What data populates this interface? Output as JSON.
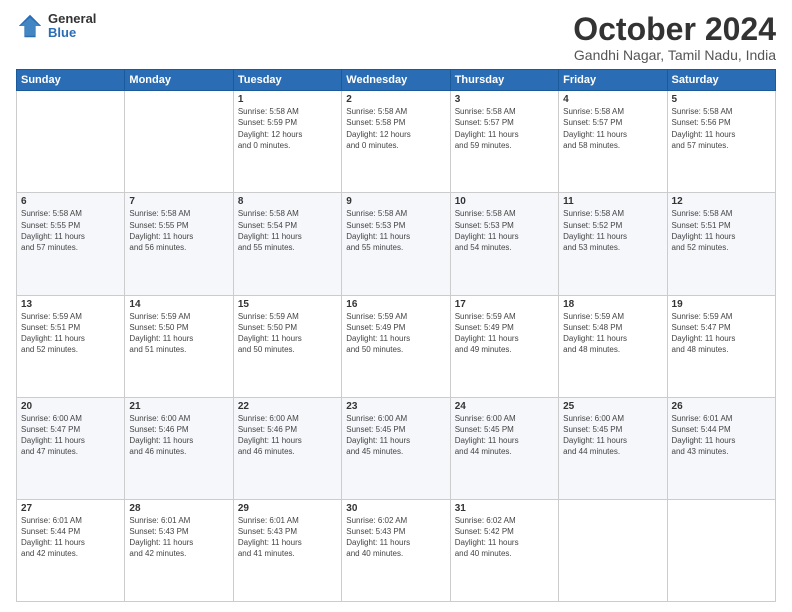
{
  "logo": {
    "general": "General",
    "blue": "Blue"
  },
  "header": {
    "month": "October 2024",
    "location": "Gandhi Nagar, Tamil Nadu, India"
  },
  "days_of_week": [
    "Sunday",
    "Monday",
    "Tuesday",
    "Wednesday",
    "Thursday",
    "Friday",
    "Saturday"
  ],
  "weeks": [
    [
      {
        "day": "",
        "info": ""
      },
      {
        "day": "",
        "info": ""
      },
      {
        "day": "1",
        "info": "Sunrise: 5:58 AM\nSunset: 5:59 PM\nDaylight: 12 hours\nand 0 minutes."
      },
      {
        "day": "2",
        "info": "Sunrise: 5:58 AM\nSunset: 5:58 PM\nDaylight: 12 hours\nand 0 minutes."
      },
      {
        "day": "3",
        "info": "Sunrise: 5:58 AM\nSunset: 5:57 PM\nDaylight: 11 hours\nand 59 minutes."
      },
      {
        "day": "4",
        "info": "Sunrise: 5:58 AM\nSunset: 5:57 PM\nDaylight: 11 hours\nand 58 minutes."
      },
      {
        "day": "5",
        "info": "Sunrise: 5:58 AM\nSunset: 5:56 PM\nDaylight: 11 hours\nand 57 minutes."
      }
    ],
    [
      {
        "day": "6",
        "info": "Sunrise: 5:58 AM\nSunset: 5:55 PM\nDaylight: 11 hours\nand 57 minutes."
      },
      {
        "day": "7",
        "info": "Sunrise: 5:58 AM\nSunset: 5:55 PM\nDaylight: 11 hours\nand 56 minutes."
      },
      {
        "day": "8",
        "info": "Sunrise: 5:58 AM\nSunset: 5:54 PM\nDaylight: 11 hours\nand 55 minutes."
      },
      {
        "day": "9",
        "info": "Sunrise: 5:58 AM\nSunset: 5:53 PM\nDaylight: 11 hours\nand 55 minutes."
      },
      {
        "day": "10",
        "info": "Sunrise: 5:58 AM\nSunset: 5:53 PM\nDaylight: 11 hours\nand 54 minutes."
      },
      {
        "day": "11",
        "info": "Sunrise: 5:58 AM\nSunset: 5:52 PM\nDaylight: 11 hours\nand 53 minutes."
      },
      {
        "day": "12",
        "info": "Sunrise: 5:58 AM\nSunset: 5:51 PM\nDaylight: 11 hours\nand 52 minutes."
      }
    ],
    [
      {
        "day": "13",
        "info": "Sunrise: 5:59 AM\nSunset: 5:51 PM\nDaylight: 11 hours\nand 52 minutes."
      },
      {
        "day": "14",
        "info": "Sunrise: 5:59 AM\nSunset: 5:50 PM\nDaylight: 11 hours\nand 51 minutes."
      },
      {
        "day": "15",
        "info": "Sunrise: 5:59 AM\nSunset: 5:50 PM\nDaylight: 11 hours\nand 50 minutes."
      },
      {
        "day": "16",
        "info": "Sunrise: 5:59 AM\nSunset: 5:49 PM\nDaylight: 11 hours\nand 50 minutes."
      },
      {
        "day": "17",
        "info": "Sunrise: 5:59 AM\nSunset: 5:49 PM\nDaylight: 11 hours\nand 49 minutes."
      },
      {
        "day": "18",
        "info": "Sunrise: 5:59 AM\nSunset: 5:48 PM\nDaylight: 11 hours\nand 48 minutes."
      },
      {
        "day": "19",
        "info": "Sunrise: 5:59 AM\nSunset: 5:47 PM\nDaylight: 11 hours\nand 48 minutes."
      }
    ],
    [
      {
        "day": "20",
        "info": "Sunrise: 6:00 AM\nSunset: 5:47 PM\nDaylight: 11 hours\nand 47 minutes."
      },
      {
        "day": "21",
        "info": "Sunrise: 6:00 AM\nSunset: 5:46 PM\nDaylight: 11 hours\nand 46 minutes."
      },
      {
        "day": "22",
        "info": "Sunrise: 6:00 AM\nSunset: 5:46 PM\nDaylight: 11 hours\nand 46 minutes."
      },
      {
        "day": "23",
        "info": "Sunrise: 6:00 AM\nSunset: 5:45 PM\nDaylight: 11 hours\nand 45 minutes."
      },
      {
        "day": "24",
        "info": "Sunrise: 6:00 AM\nSunset: 5:45 PM\nDaylight: 11 hours\nand 44 minutes."
      },
      {
        "day": "25",
        "info": "Sunrise: 6:00 AM\nSunset: 5:45 PM\nDaylight: 11 hours\nand 44 minutes."
      },
      {
        "day": "26",
        "info": "Sunrise: 6:01 AM\nSunset: 5:44 PM\nDaylight: 11 hours\nand 43 minutes."
      }
    ],
    [
      {
        "day": "27",
        "info": "Sunrise: 6:01 AM\nSunset: 5:44 PM\nDaylight: 11 hours\nand 42 minutes."
      },
      {
        "day": "28",
        "info": "Sunrise: 6:01 AM\nSunset: 5:43 PM\nDaylight: 11 hours\nand 42 minutes."
      },
      {
        "day": "29",
        "info": "Sunrise: 6:01 AM\nSunset: 5:43 PM\nDaylight: 11 hours\nand 41 minutes."
      },
      {
        "day": "30",
        "info": "Sunrise: 6:02 AM\nSunset: 5:43 PM\nDaylight: 11 hours\nand 40 minutes."
      },
      {
        "day": "31",
        "info": "Sunrise: 6:02 AM\nSunset: 5:42 PM\nDaylight: 11 hours\nand 40 minutes."
      },
      {
        "day": "",
        "info": ""
      },
      {
        "day": "",
        "info": ""
      }
    ]
  ]
}
